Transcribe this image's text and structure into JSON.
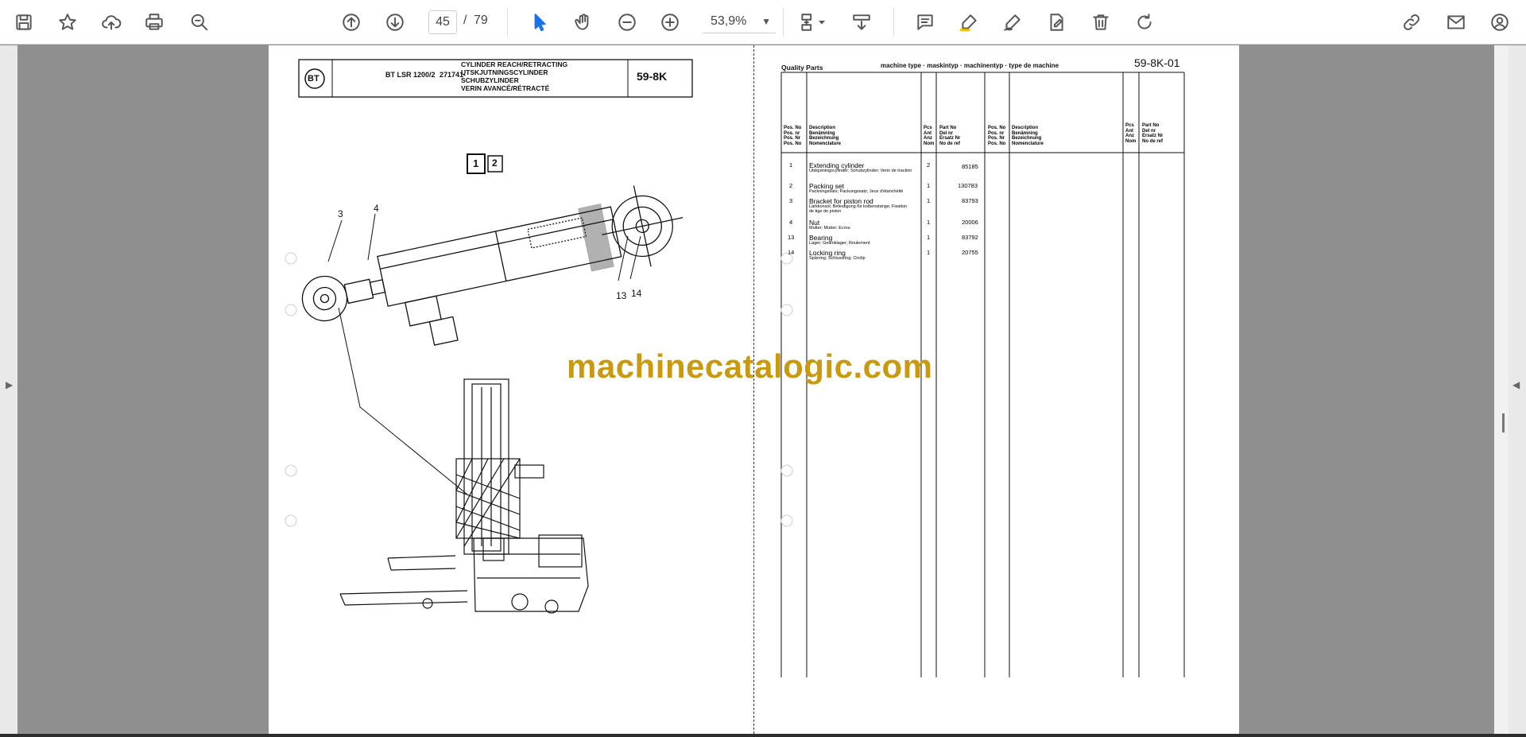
{
  "toolbar": {
    "page_current": "45",
    "page_separator": "/",
    "page_total": "79",
    "zoom": "53,9%",
    "icons": [
      "save-icon",
      "bookmark-icon",
      "upload-icon",
      "print-icon",
      "find-icon",
      "prev-page-icon",
      "next-page-icon",
      "select-cursor-icon",
      "hand-icon",
      "zoom-out-icon",
      "zoom-in-icon",
      "fit-page-icon",
      "scroll-mode-icon",
      "comment-icon",
      "highlight-icon",
      "draw-icon",
      "fill-sign-icon",
      "delete-icon",
      "rotate-icon",
      "share-link-icon",
      "email-icon",
      "account-icon"
    ]
  },
  "left_page": {
    "header": {
      "logo": "BT",
      "model": "BT LSR 1200/2",
      "serial": "271741-",
      "titles": [
        "CYLINDER REACH/RETRACTING",
        "UTSKJUTNINGSCYLINDER",
        "SCHUBZYLINDER",
        "VERIN AVANCÉ/RÉTRACTÉ"
      ],
      "code": "59-8K"
    },
    "page_indicators": [
      "1",
      "2"
    ],
    "callouts": [
      "3",
      "4",
      "13",
      "14"
    ]
  },
  "right_page": {
    "top_left": "Quality Parts",
    "top_center": "machine type · maskintyp · machinentyp · type de machine",
    "code": "59-8K-01",
    "headers": {
      "pos": [
        "Pos. No",
        "Pos. nr",
        "Pos. Nr",
        "Pos. No"
      ],
      "desc": [
        "Description",
        "Benämning",
        "Bezeichnung",
        "Nomenclature"
      ],
      "qty": [
        "Pcs",
        "Ant",
        "Anz",
        "Nom"
      ],
      "part": [
        "Part No",
        "Del nr",
        "Ersatz Nr",
        "No de ref"
      ]
    },
    "rows": [
      {
        "pos": "1",
        "name": "Extending cylinder",
        "sub": "Utskjutningscylinder; Schubzylinder; Verin de traction",
        "qty": "2",
        "part": "85185"
      },
      {
        "pos": "2",
        "name": "Packing set",
        "sub": "Packningssats; Packungssatz; Jeux d'étanchéité",
        "qty": "1",
        "part": "130783"
      },
      {
        "pos": "3",
        "name": "Bracket for piston rod",
        "sub": "Lärkkonsol; Befestigung für kolbenstange; Fixation de tige de piston",
        "qty": "1",
        "part": "83793"
      },
      {
        "pos": "4",
        "name": "Nut",
        "sub": "Mutter; Mutter; Ecrou",
        "qty": "1",
        "part": "20006"
      },
      {
        "pos": "13",
        "name": "Bearing",
        "sub": "Lager; Gelenklager; Roulement",
        "qty": "1",
        "part": "83792"
      },
      {
        "pos": "14",
        "name": "Locking ring",
        "sub": "Spårring; Schlussring; Circlip",
        "qty": "1",
        "part": "20755"
      }
    ]
  },
  "watermark": "machinecatalogic.com"
}
